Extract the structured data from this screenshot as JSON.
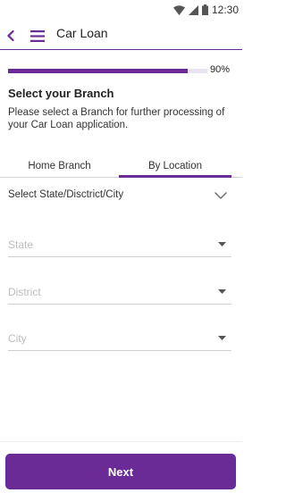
{
  "status_bar": {
    "time": "12:30"
  },
  "app_bar": {
    "title": "Car Loan"
  },
  "progress": {
    "value": 0.9,
    "label": "90%"
  },
  "section": {
    "title": "Select your Branch",
    "description": "Please select a Branch for further processing of your Car Loan application."
  },
  "tabs": [
    {
      "label": "Home Branch",
      "active": false
    },
    {
      "label": "By Location",
      "active": true
    }
  ],
  "accordion": {
    "label": "Select State/Disctrict/City"
  },
  "fields": {
    "state": {
      "placeholder": "State"
    },
    "district": {
      "placeholder": "District"
    },
    "city": {
      "placeholder": "City"
    }
  },
  "footer": {
    "next_label": "Next"
  },
  "colors": {
    "accent": "#6a2b96",
    "track": "#e9e2f0",
    "placeholder": "#bcbcbc"
  },
  "icons": {
    "status": [
      "wifi-icon",
      "signal-icon",
      "battery-icon"
    ],
    "back": "chevron-left-icon",
    "menu": "hamburger-menu-icon",
    "accordion": "chevron-down-icon",
    "select": "caret-down-icon"
  }
}
